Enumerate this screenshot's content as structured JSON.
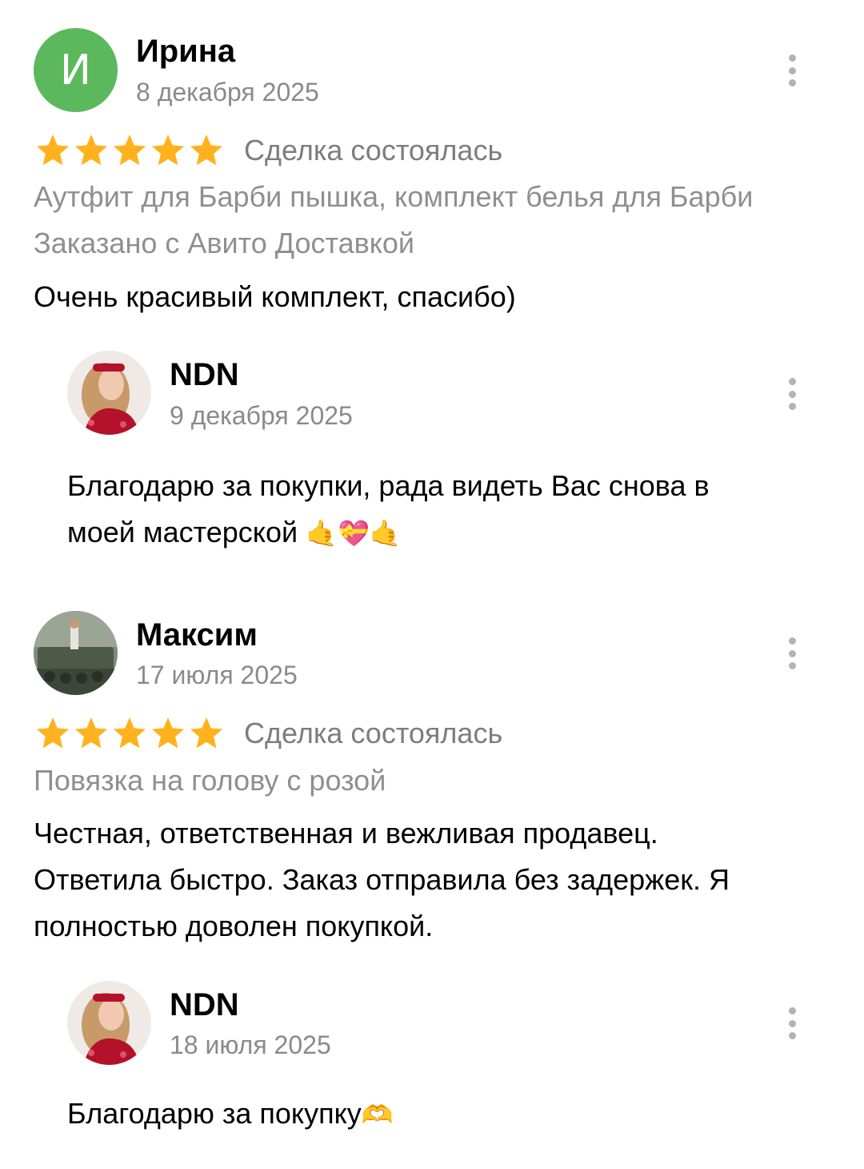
{
  "reviews": [
    {
      "author": "Ирина",
      "avatar_letter": "И",
      "date": "8 декабря 2025",
      "rating": 5,
      "deal_status": "Сделка состоялась",
      "item": "Аутфит для Барби пышка, комплект белья для Барби",
      "delivery": "Заказано с Авито Доставкой",
      "text": "Очень красивый комплект, спасибо)",
      "reply": {
        "author": "NDN",
        "date": "9 декабря 2025",
        "text_line1": "Благодарю за покупки, рада видеть Вас снова в",
        "text_line2": "моей мастерской",
        "emoji": "🤙💝🤙"
      }
    },
    {
      "author": "Максим",
      "date": "17 июля 2025",
      "rating": 5,
      "deal_status": "Сделка состоялась",
      "item": "Повязка на голову с розой",
      "text_line1": "Честная, ответственная и вежливая  продавец.",
      "text_line2": "Ответила быстро. Заказ отправила без задержек. Я",
      "text_line3": "полностью доволен покупкой.",
      "reply": {
        "author": "NDN",
        "date": "18 июля 2025",
        "text": "Благодарю за покупку",
        "emoji": "🫶"
      }
    }
  ],
  "colors": {
    "star": "#ffb21e",
    "letter_avatar_bg": "#5cb85c",
    "secondary_text": "#8a8a8a"
  }
}
